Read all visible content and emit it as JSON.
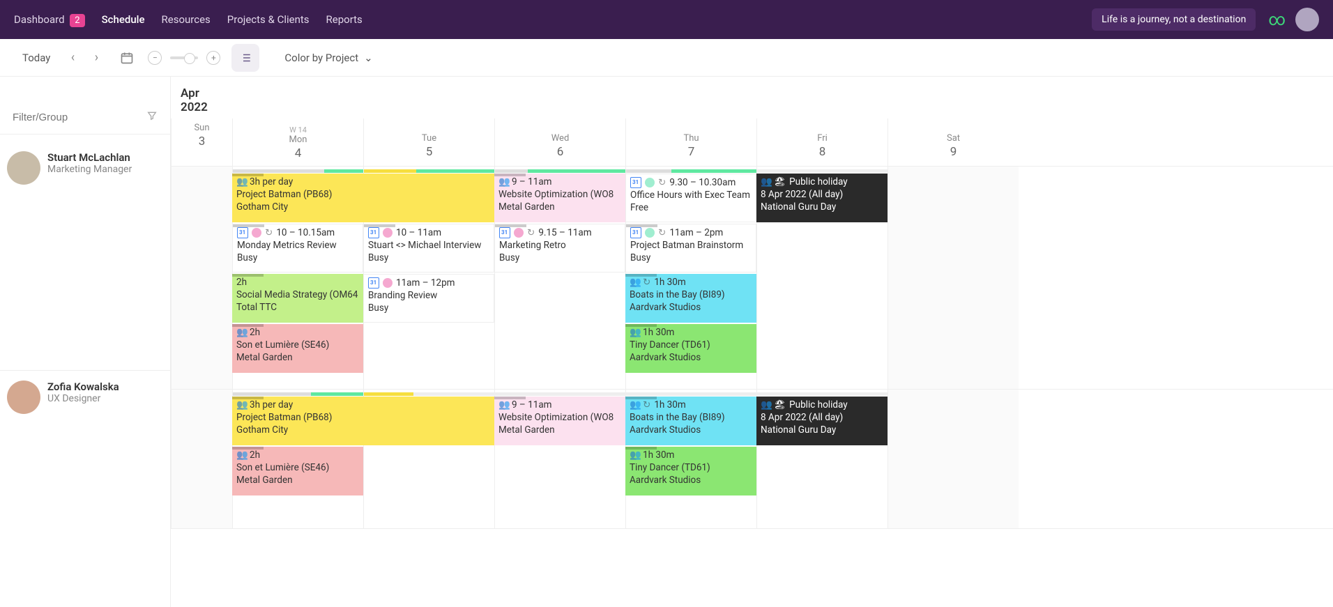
{
  "nav": {
    "dashboard": "Dashboard",
    "dashboard_badge": "2",
    "schedule": "Schedule",
    "resources": "Resources",
    "projects": "Projects & Clients",
    "reports": "Reports"
  },
  "quote": "Life is a journey, not a destination",
  "toolbar": {
    "today": "Today",
    "color_by": "Color by Project"
  },
  "date_label": "Apr 2022",
  "week_label": "W 14",
  "filter_placeholder": "Filter/Group",
  "days": [
    {
      "dow": "Sun",
      "num": "3"
    },
    {
      "dow": "Mon",
      "num": "4"
    },
    {
      "dow": "Tue",
      "num": "5"
    },
    {
      "dow": "Wed",
      "num": "6"
    },
    {
      "dow": "Thu",
      "num": "7"
    },
    {
      "dow": "Fri",
      "num": "8"
    },
    {
      "dow": "Sat",
      "num": "9"
    }
  ],
  "people": [
    {
      "name": "Stuart McLachlan",
      "role": "Marketing Manager"
    },
    {
      "name": "Zofia Kowalska",
      "role": "UX Designer"
    }
  ],
  "holiday": {
    "title": "Public holiday",
    "date": "8 Apr 2022 (All day)",
    "name": "National Guru Day"
  },
  "evt": {
    "pb68_dur": "3h per day",
    "pb68_title": "Project Batman (PB68)",
    "pb68_client": "Gotham City",
    "wo8_time": "9 – 11am",
    "wo8_title": "Website Optimization (WO8",
    "wo8_client": "Metal Garden",
    "office_time": "9.30 – 10.30am",
    "office_title": "Office Hours with Exec Team",
    "office_status": "Free",
    "mon_metrics_time": "10 – 10.15am",
    "mon_metrics_title": "Monday Metrics Review",
    "busy": "Busy",
    "stuart_int_time": "10 – 11am",
    "stuart_int_title": "Stuart <> Michael Interview",
    "retro_time": "9.15 – 11am",
    "retro_title": "Marketing Retro",
    "brainstorm_time": "11am – 2pm",
    "brainstorm_title": "Project Batman Brainstorm",
    "social_dur": "2h",
    "social_title": "Social Media Strategy (OM64",
    "social_client": "Total TTC",
    "branding_time": "11am – 12pm",
    "branding_title": "Branding Review",
    "boats_dur": "1h 30m",
    "boats_title": "Boats in the Bay (BI89)",
    "boats_client": "Aardvark Studios",
    "sel_dur": "2h",
    "sel_title": "Son et Lumière (SE46)",
    "sel_client": "Metal Garden",
    "tiny_dur": "1h 30m",
    "tiny_title": "Tiny Dancer (TD61)",
    "tiny_client": "Aardvark Studios"
  }
}
